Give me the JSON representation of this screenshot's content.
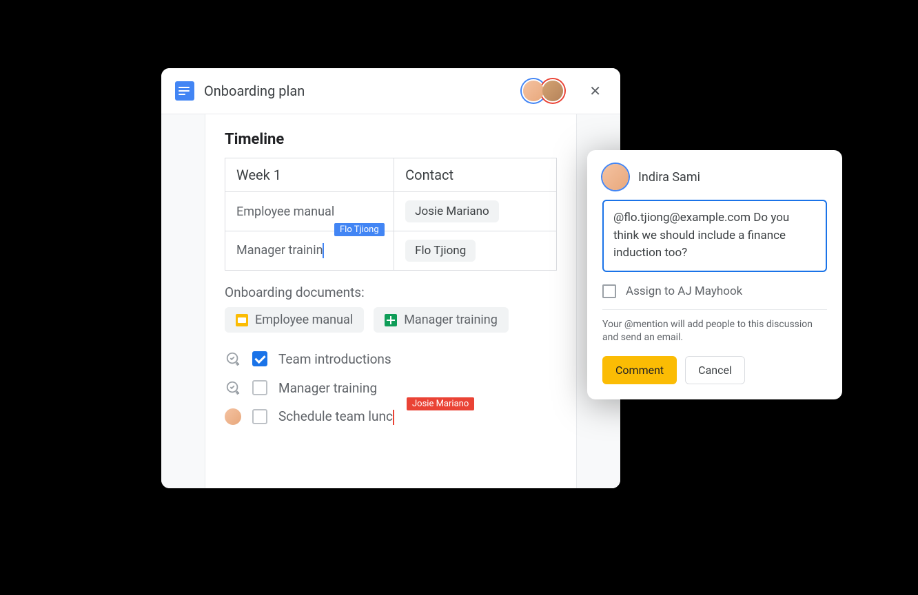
{
  "doc": {
    "title": "Onboarding plan",
    "section_title": "Timeline",
    "table": {
      "headers": [
        "Week 1",
        "Contact"
      ],
      "rows": [
        {
          "label": "Employee manual",
          "contact": "Josie Mariano"
        },
        {
          "label": "Manager trainin",
          "contact": "Flo Tjiong",
          "editing_by": "Flo Tjiong"
        }
      ]
    },
    "docs_label": "Onboarding documents:",
    "doc_chips": [
      {
        "icon": "slides",
        "label": "Employee manual"
      },
      {
        "icon": "sheets",
        "label": "Manager training"
      }
    ],
    "checklist": [
      {
        "icon": "assign",
        "checked": true,
        "label": "Team introductions"
      },
      {
        "icon": "assign",
        "checked": false,
        "label": "Manager training"
      },
      {
        "icon": "avatar",
        "checked": false,
        "label": "Schedule team lunc",
        "editing_by": "Josie Mariano"
      }
    ]
  },
  "comment": {
    "author": "Indira Sami",
    "text": "@flo.tjiong@example.com Do you think we should include a finance induction too?",
    "assign_to": "Assign to AJ Mayhook",
    "mention_note": "Your @mention will add people to this discussion and send an email.",
    "actions": {
      "primary": "Comment",
      "secondary": "Cancel"
    }
  }
}
